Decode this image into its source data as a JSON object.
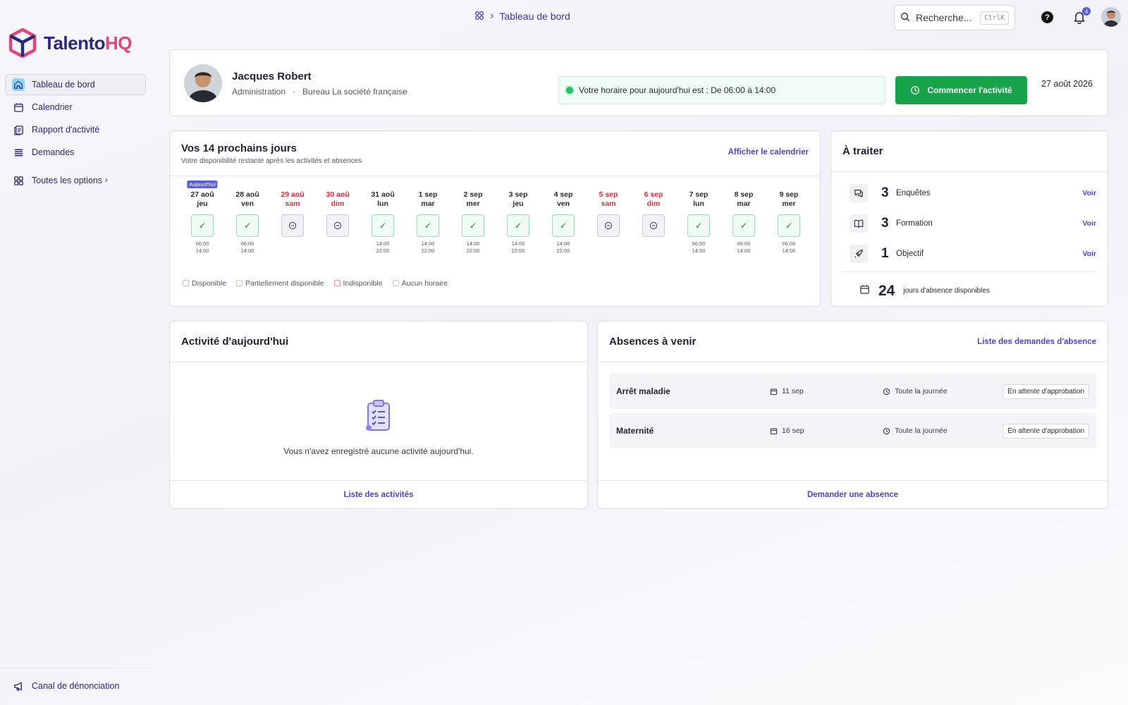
{
  "app": {
    "logo_part1": "Talento",
    "logo_part2": "HQ"
  },
  "sidebar": {
    "items": [
      {
        "label": "Tableau de bord"
      },
      {
        "label": "Calendrier"
      },
      {
        "label": "Rapport d'activité"
      },
      {
        "label": "Demandes"
      }
    ],
    "more_label": "Toutes les options",
    "bottom_label": "Canal de dénonciation"
  },
  "topbar": {
    "breadcrumb": "Tableau de bord",
    "search_placeholder": "Recherche...",
    "search_shortcut": "CtrlK",
    "notification_count": "4"
  },
  "profile": {
    "name": "Jacques Robert",
    "department": "Administration",
    "separator": "·",
    "office": "Bureau La société française",
    "schedule_text": "Votre horaire pour aujourd'hui est : De 06:00 à 14:00",
    "start_button": "Commencer l'activité",
    "date": "27 août 2026"
  },
  "days": {
    "title": "Vos 14 prochains jours",
    "subtitle": "Votre disponibilité restante après les activités et absences",
    "link": "Afficher le calendrier",
    "today_tag": "Aujourd'hui",
    "list": [
      {
        "date": "27 aoû",
        "weekday": "jeu",
        "status": "ok",
        "start": "06:00",
        "end": "14:00",
        "weekend": false
      },
      {
        "date": "28 aoû",
        "weekday": "ven",
        "status": "ok",
        "start": "06:00",
        "end": "14:00",
        "weekend": false
      },
      {
        "date": "29 aoû",
        "weekday": "sam",
        "status": "none",
        "start": "",
        "end": "",
        "weekend": true
      },
      {
        "date": "30 aoû",
        "weekday": "dim",
        "status": "none",
        "start": "",
        "end": "",
        "weekend": true
      },
      {
        "date": "31 aoû",
        "weekday": "lun",
        "status": "ok",
        "start": "14:00",
        "end": "22:00",
        "weekend": false
      },
      {
        "date": "1 sep",
        "weekday": "mar",
        "status": "ok",
        "start": "14:00",
        "end": "22:00",
        "weekend": false
      },
      {
        "date": "2 sep",
        "weekday": "mer",
        "status": "ok",
        "start": "14:00",
        "end": "22:00",
        "weekend": false
      },
      {
        "date": "3 sep",
        "weekday": "jeu",
        "status": "ok",
        "start": "14:00",
        "end": "22:00",
        "weekend": false
      },
      {
        "date": "4 sep",
        "weekday": "ven",
        "status": "ok",
        "start": "14:00",
        "end": "22:00",
        "weekend": false
      },
      {
        "date": "5 sep",
        "weekday": "sam",
        "status": "none",
        "start": "",
        "end": "",
        "weekend": true
      },
      {
        "date": "6 sep",
        "weekday": "dim",
        "status": "none",
        "start": "",
        "end": "",
        "weekend": true
      },
      {
        "date": "7 sep",
        "weekday": "lun",
        "status": "ok",
        "start": "06:00",
        "end": "14:00",
        "weekend": false
      },
      {
        "date": "8 sep",
        "weekday": "mar",
        "status": "ok",
        "start": "06:00",
        "end": "14:00",
        "weekend": false
      },
      {
        "date": "9 sep",
        "weekday": "mer",
        "status": "ok",
        "start": "06:00",
        "end": "14:00",
        "weekend": false
      }
    ],
    "legend": [
      {
        "label": "Disponible",
        "color": "#9ddcb3"
      },
      {
        "label": "Partiellement disponible",
        "color": "#f3c26b"
      },
      {
        "label": "Indisponible",
        "color": "#ef8a96"
      },
      {
        "label": "Aucun horaire",
        "color": "#c9cad4"
      }
    ]
  },
  "todo": {
    "title": "À traiter",
    "items": [
      {
        "count": "3",
        "label": "Enquêtes",
        "link": "Voir"
      },
      {
        "count": "3",
        "label": "Formation",
        "link": "Voir"
      },
      {
        "count": "1",
        "label": "Objectif",
        "link": "Voir"
      }
    ],
    "absence_days": "24",
    "absence_label": "jours d'absence disponibles"
  },
  "activity": {
    "title": "Activité d'aujourd'hui",
    "empty_text": "Vous n'avez enregistré aucune activité aujourd'hui.",
    "footer_link": "Liste des activités"
  },
  "absences": {
    "title": "Absences à venir",
    "link": "Liste des demandes d'absence",
    "items": [
      {
        "type": "Arrêt maladie",
        "date": "11 sep",
        "duration": "Toute la journée",
        "status": "En attente d'approbation"
      },
      {
        "type": "Maternité",
        "date": "16 sep",
        "duration": "Toute la journée",
        "status": "En attente d'approbation"
      }
    ],
    "footer_link": "Demander une absence"
  },
  "colors": {
    "brand": "#2b2a7a",
    "accent": "#4b47c4",
    "brand_pink": "#e0487b",
    "success": "#16a34a",
    "weekend": "#d0303a"
  }
}
